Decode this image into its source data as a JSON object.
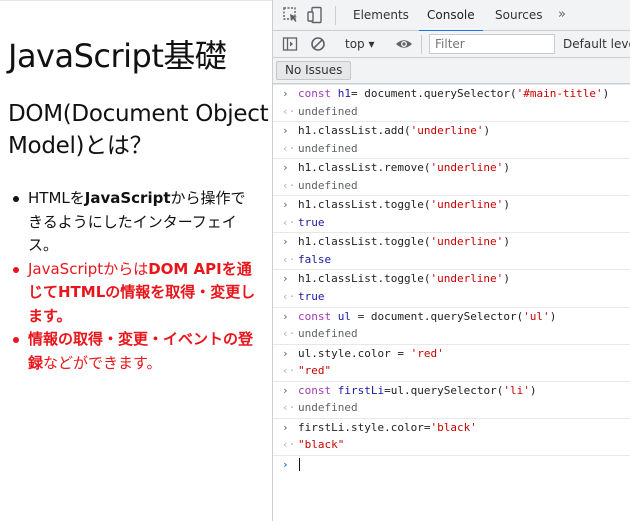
{
  "page": {
    "title": "JavaScript基礎",
    "subtitle": "DOM(Document Object Model)とは？",
    "list": [
      {
        "segments": [
          {
            "t": "HTMLを"
          },
          {
            "t": "JavaScript",
            "bold": true
          },
          {
            "t": "から操作できるようにしたインターフェイス。"
          }
        ],
        "color": "#111111"
      },
      {
        "segments": [
          {
            "t": "JavaScriptからは"
          },
          {
            "t": "DOM APIを通じてHTMLの情報を取得・変更します。",
            "bold": true
          }
        ],
        "color": "#e8161b"
      },
      {
        "segments": [
          {
            "t": "情報の取得・変更・イベントの登録",
            "bold": true
          },
          {
            "t": "などができます。"
          }
        ],
        "color": "#e8161b"
      }
    ]
  },
  "devtools": {
    "tabs": [
      "Elements",
      "Console",
      "Sources"
    ],
    "active_tab": "Console",
    "more": "»",
    "context": "top ▾",
    "filter_placeholder": "Filter",
    "levels": "Default levels",
    "issues": "No Issues",
    "console": [
      {
        "kind": "in",
        "parts": [
          [
            "kw",
            "const "
          ],
          [
            "var",
            "h1"
          ],
          [
            "",
            "= document.querySelector("
          ],
          [
            "str",
            "'#main-title'"
          ],
          [
            "",
            ")"
          ]
        ]
      },
      {
        "kind": "out",
        "parts": [
          [
            "undef",
            "undefined"
          ]
        ]
      },
      {
        "kind": "in",
        "parts": [
          [
            "",
            "h1.classList.add("
          ],
          [
            "str",
            "'underline'"
          ],
          [
            "",
            ")"
          ]
        ]
      },
      {
        "kind": "out",
        "parts": [
          [
            "undef",
            "undefined"
          ]
        ]
      },
      {
        "kind": "in",
        "parts": [
          [
            "",
            "h1.classList.remove("
          ],
          [
            "str",
            "'underline'"
          ],
          [
            "",
            ")"
          ]
        ]
      },
      {
        "kind": "out",
        "parts": [
          [
            "undef",
            "undefined"
          ]
        ]
      },
      {
        "kind": "in",
        "parts": [
          [
            "",
            "h1.classList.toggle("
          ],
          [
            "str",
            "'underline'"
          ],
          [
            "",
            ")"
          ]
        ]
      },
      {
        "kind": "out",
        "parts": [
          [
            "bool",
            "true"
          ]
        ]
      },
      {
        "kind": "in",
        "parts": [
          [
            "",
            "h1.classList.toggle("
          ],
          [
            "str",
            "'underline'"
          ],
          [
            "",
            ")"
          ]
        ]
      },
      {
        "kind": "out",
        "parts": [
          [
            "bool",
            "false"
          ]
        ]
      },
      {
        "kind": "in",
        "parts": [
          [
            "",
            "h1.classList.toggle("
          ],
          [
            "str",
            "'underline'"
          ],
          [
            "",
            ")"
          ]
        ]
      },
      {
        "kind": "out",
        "parts": [
          [
            "bool",
            "true"
          ]
        ]
      },
      {
        "kind": "in",
        "parts": [
          [
            "kw",
            "const "
          ],
          [
            "var",
            "ul"
          ],
          [
            "",
            " = document.querySelector("
          ],
          [
            "str",
            "'ul'"
          ],
          [
            "",
            ")"
          ]
        ]
      },
      {
        "kind": "out",
        "parts": [
          [
            "undef",
            "undefined"
          ]
        ]
      },
      {
        "kind": "in",
        "parts": [
          [
            "",
            "ul.style.color = "
          ],
          [
            "str",
            "'red'"
          ]
        ]
      },
      {
        "kind": "out",
        "parts": [
          [
            "ostr",
            "\"red\""
          ]
        ]
      },
      {
        "kind": "in",
        "parts": [
          [
            "kw",
            "const "
          ],
          [
            "var",
            "firstLi"
          ],
          [
            "",
            "=ul.querySelector("
          ],
          [
            "str",
            "'li'"
          ],
          [
            "",
            ")"
          ]
        ]
      },
      {
        "kind": "out",
        "parts": [
          [
            "undef",
            "undefined"
          ]
        ]
      },
      {
        "kind": "in",
        "parts": [
          [
            "",
            "firstLi.style.color="
          ],
          [
            "str",
            "'black'"
          ]
        ]
      },
      {
        "kind": "out",
        "parts": [
          [
            "ostr",
            "\"black\""
          ]
        ]
      }
    ]
  }
}
